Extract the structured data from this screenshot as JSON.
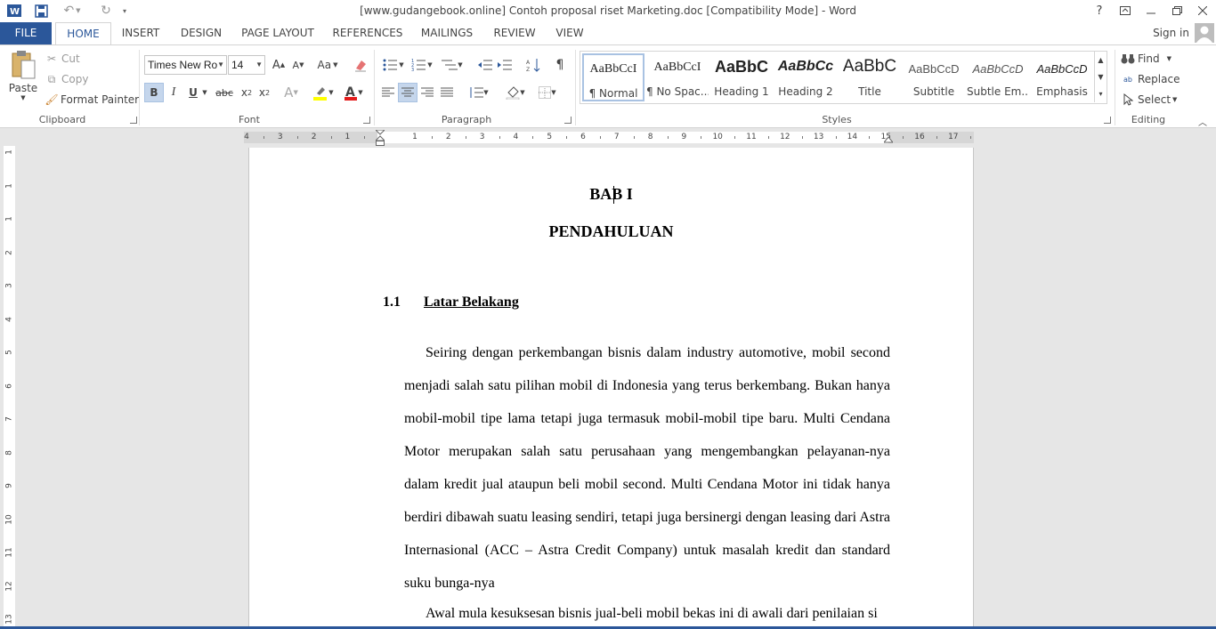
{
  "window": {
    "title": "[www.gudangebook.online] Contoh proposal riset Marketing.doc [Compatibility Mode] - Word",
    "app_icon": "word-icon",
    "quick_access": [
      "save-icon",
      "undo-icon",
      "redo-icon",
      "customize-qat-icon"
    ],
    "controls": {
      "help": "?",
      "ribbon_options": "ribbon-display-icon",
      "minimize": "minimize-icon",
      "restore": "restore-icon",
      "close": "close-icon"
    }
  },
  "tabs": [
    {
      "label": "FILE"
    },
    {
      "label": "HOME"
    },
    {
      "label": "INSERT"
    },
    {
      "label": "DESIGN"
    },
    {
      "label": "PAGE LAYOUT"
    },
    {
      "label": "REFERENCES"
    },
    {
      "label": "MAILINGS"
    },
    {
      "label": "REVIEW"
    },
    {
      "label": "VIEW"
    }
  ],
  "account": {
    "sign_in": "Sign in"
  },
  "ribbon": {
    "clipboard": {
      "label": "Clipboard",
      "paste": "Paste",
      "cut": "Cut",
      "copy": "Copy",
      "format_painter": "Format Painter"
    },
    "font": {
      "label": "Font",
      "font_name": "Times New Ro",
      "font_size": "14",
      "grow": "A",
      "shrink": "A",
      "change_case": "Aa",
      "bold": "B",
      "italic": "I",
      "underline": "U",
      "strikethrough": "abc",
      "subscript": "x",
      "superscript": "x",
      "text_effects": "A",
      "font_color": "A",
      "highlight_color": "#ffff00",
      "font_color_value": "#e31b1b"
    },
    "paragraph": {
      "label": "Paragraph"
    },
    "styles": {
      "label": "Styles",
      "items": [
        {
          "sample": "AaBbCcI",
          "name": "¶ Normal"
        },
        {
          "sample": "AaBbCcI",
          "name": "¶ No Spac..."
        },
        {
          "sample": "AaBbC",
          "name": "Heading 1"
        },
        {
          "sample": "AaBbCc",
          "name": "Heading 2"
        },
        {
          "sample": "AaBbC",
          "name": "Title"
        },
        {
          "sample": "AaBbCcD",
          "name": "Subtitle"
        },
        {
          "sample": "AaBbCcD",
          "name": "Subtle Em..."
        },
        {
          "sample": "AaBbCcD",
          "name": "Emphasis"
        }
      ]
    },
    "editing": {
      "label": "Editing",
      "find": "Find",
      "replace": "Replace",
      "select": "Select"
    }
  },
  "ruler": {
    "horizontal": [
      "4",
      "3",
      "2",
      "1",
      "1",
      "2",
      "3",
      "4",
      "5",
      "6",
      "7",
      "8",
      "9",
      "10",
      "11",
      "12",
      "13",
      "14",
      "15",
      "16",
      "17"
    ],
    "vertical": [
      "1",
      "1",
      "1",
      "2",
      "3",
      "4",
      "5",
      "6",
      "7",
      "8",
      "9",
      "10",
      "11",
      "12",
      "13"
    ]
  },
  "document": {
    "chapter": "BAB I",
    "chapter_title": "PENDAHULUAN",
    "section_number": "1.1",
    "section_title": "Latar Belakang",
    "paragraph1": "Seiring dengan perkembangan bisnis dalam industry automotive, mobil second menjadi salah satu pilihan mobil di Indonesia yang terus berkembang. Bukan hanya mobil-mobil tipe lama tetapi juga termasuk mobil-mobil tipe baru. Multi Cendana Motor merupakan salah satu perusahaan yang mengembangkan pelayanan-nya dalam kredit jual ataupun beli mobil second. Multi Cendana Motor ini tidak hanya berdiri dibawah suatu leasing sendiri, tetapi juga bersinergi dengan leasing dari Astra Internasional (ACC – Astra Credit Company) untuk masalah kredit dan standard suku bunga-nya",
    "paragraph2": "Awal mula kesuksesan bisnis jual-beli mobil bekas ini di awali dari penilaian si"
  }
}
